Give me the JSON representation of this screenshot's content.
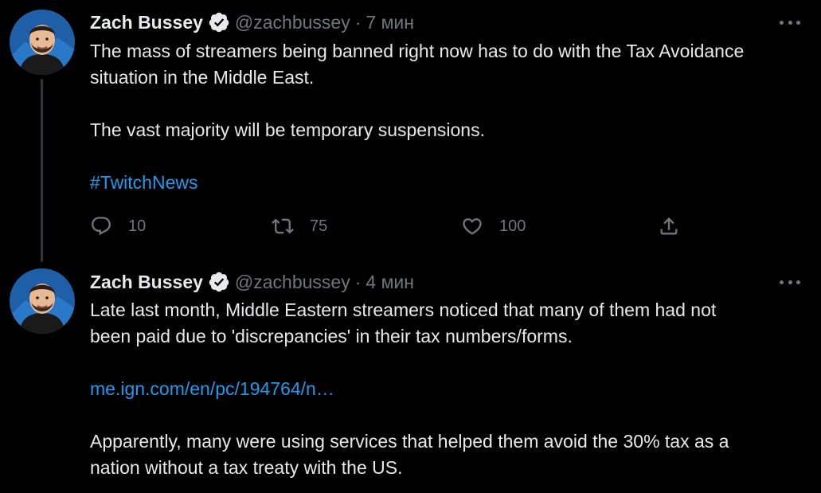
{
  "tweets": [
    {
      "author": {
        "name": "Zach Bussey",
        "handle": "@zachbussey",
        "verified": true
      },
      "separator": "·",
      "time": "7 мин",
      "body": {
        "line1": "The mass of streamers being banned right now has to do with the Tax Avoidance",
        "line2": "situation in the Middle East.",
        "line3": "The vast majority will be temporary suspensions.",
        "hashtag": "#TwitchNews"
      },
      "actions": {
        "reply_count": "10",
        "retweet_count": "75",
        "like_count": "100"
      }
    },
    {
      "author": {
        "name": "Zach Bussey",
        "handle": "@zachbussey",
        "verified": true
      },
      "separator": "·",
      "time": "4 мин",
      "body": {
        "line1": "Late last month, Middle Eastern streamers noticed that many of them had not",
        "line2": "been paid due to 'discrepancies' in their tax numbers/forms.",
        "link": "me.ign.com/en/pc/194764/n…",
        "line3": "Apparently, many were using services that helped them avoid the 30% tax as a",
        "line4": "nation without a tax treaty with the US."
      }
    }
  ],
  "icons": {
    "verified": "verified-badge-icon",
    "more": "more-horizontal-icon",
    "reply": "reply-bubble-icon",
    "retweet": "retweet-arrows-icon",
    "like": "heart-icon",
    "share": "share-upload-icon"
  },
  "colors": {
    "background": "#000000",
    "text_primary": "#e7e9ea",
    "text_secondary": "#71767b",
    "link": "#1d9bf0",
    "thread_line": "#333639"
  }
}
